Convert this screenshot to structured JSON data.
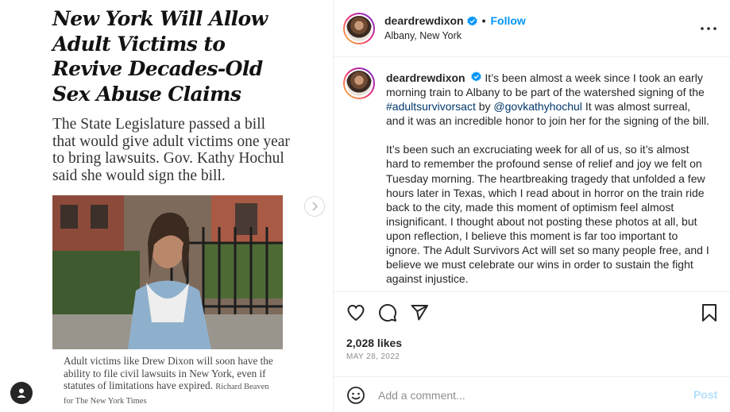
{
  "media": {
    "headline": "New York Will Allow Adult Victims to Revive Decades-Old Sex Abuse Claims",
    "deck": "The State Legislature passed a bill that would give adult victims one year to bring lawsuits. Gov. Kathy Hochul said she would sign the bill.",
    "photo_caption": "Adult victims like Drew Dixon will soon have the ability to file civil lawsuits in New York, even if statutes of limitations have expired.",
    "photo_credit": "Richard Beaven for The New York Times"
  },
  "header": {
    "username": "deardrewdixon",
    "separator": "•",
    "follow_label": "Follow",
    "location": "Albany, New York"
  },
  "caption": {
    "username": "deardrewdixon",
    "p1_a": "It’s been almost a week since I took an early morning train to Albany to be part of the watershed signing of the",
    "hashtag": "#adultsurvivorsact",
    "p1_b": "by",
    "mention": "@govkathyhochul",
    "p1_c": "It was almost surreal, and it was an incredible honor to join her for the signing of the bill.",
    "p2": "It’s been such an excruciating week for all of us, so it’s almost hard to remember the profound sense of relief and joy we felt on Tuesday morning. The heartbreaking tragedy that unfolded a few hours later in Texas, which I read about in horror on the train ride back to the city, made this moment of optimism feel almost insignificant. I thought about not posting these photos at all, but upon reflection, I believe this moment is far too important to ignore. The Adult Survivors Act will set so many people free, and I believe we must celebrate our wins in order to sustain the fight against injustice."
  },
  "stats": {
    "likes": "2,028 likes",
    "date": "MAY 28, 2022"
  },
  "comment": {
    "placeholder": "Add a comment...",
    "post_label": "Post"
  },
  "colors": {
    "accent": "#0095f6",
    "link": "#00376b",
    "muted": "#8e8e8e",
    "post_disabled": "#b2dffc"
  }
}
